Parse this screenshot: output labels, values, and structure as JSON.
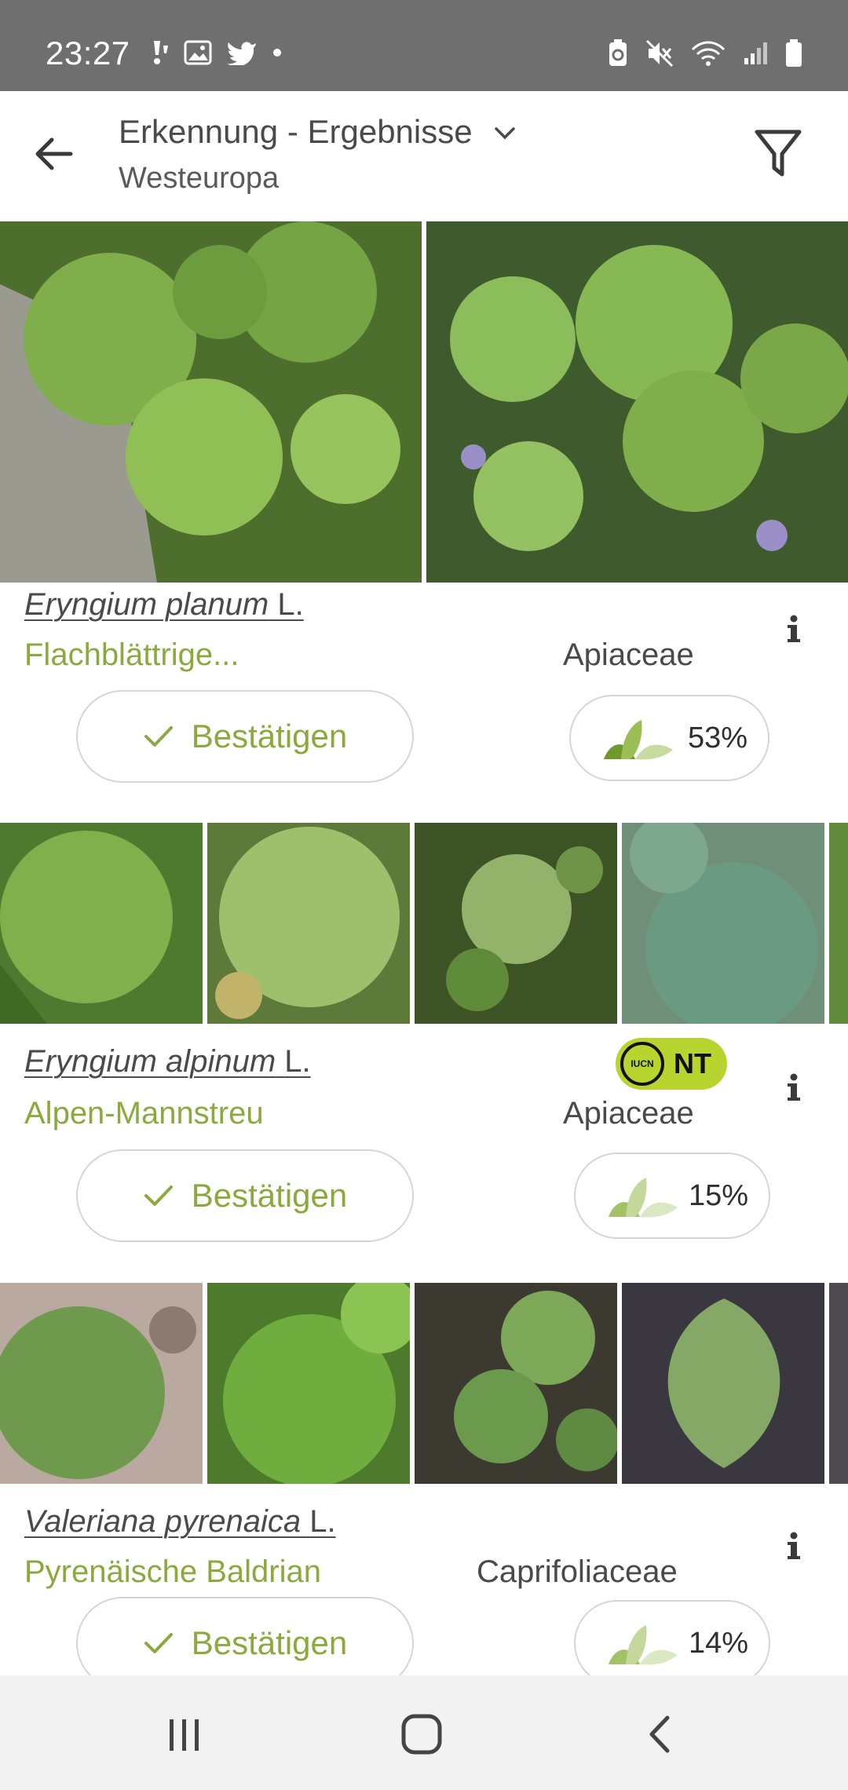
{
  "status_bar": {
    "time": "23:27",
    "left_icons": [
      "notification-icon",
      "image-icon",
      "twitter-icon",
      "dot-icon"
    ],
    "right_icons": [
      "battery-saver-icon",
      "mute-icon",
      "wifi-icon",
      "signal-icon",
      "battery-icon"
    ]
  },
  "app_bar": {
    "title": "Erkennung - Ergebnisse",
    "subtitle": "Westeuropa",
    "back_icon": "arrow-left-icon",
    "dropdown_icon": "chevron-down-icon",
    "filter_icon": "filter-icon"
  },
  "results": [
    {
      "scientific_name": "Eryngium planum",
      "author": "L.",
      "common_name": "Flachblättrige...",
      "family": "Apiaceae",
      "confirm_label": "Bestätigen",
      "score": "53%",
      "iucn": null,
      "photo_colors": [
        "#5f8a3a",
        "#6c9143"
      ]
    },
    {
      "scientific_name": "Eryngium alpinum",
      "author": "L.",
      "common_name": "Alpen-Mannstreu",
      "family": "Apiaceae",
      "confirm_label": "Bestätigen",
      "score": "15%",
      "iucn": {
        "label": "IUCN",
        "code": "NT"
      },
      "photo_colors": [
        "#74a34a",
        "#83a955",
        "#526b34",
        "#6b8d5e",
        "#5f8a3a"
      ]
    },
    {
      "scientific_name": "Valeriana pyrenaica",
      "author": "L.",
      "common_name": "Pyrenäische Baldrian",
      "family": "Caprifoliaceae",
      "confirm_label": "Bestätigen",
      "score": "14%",
      "iucn": null,
      "photo_colors": [
        "#6f8f4d",
        "#5f9838",
        "#4f5e3a",
        "#7d9a57",
        "#5e7a48"
      ]
    }
  ],
  "colors": {
    "accent": "#8aab3c",
    "status_bar": "#6f6f6f",
    "iucn_badge": "#b8d42e"
  },
  "nav": {
    "recents_icon": "recent-apps-icon",
    "home_icon": "home-icon",
    "back_icon": "back-icon"
  }
}
